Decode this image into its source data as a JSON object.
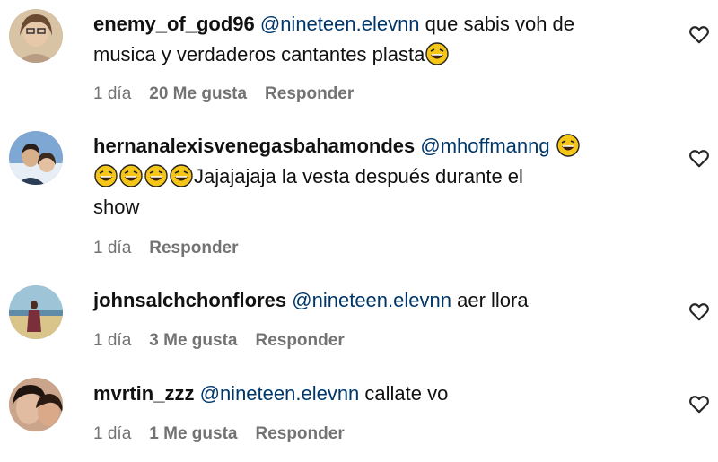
{
  "comments": [
    {
      "username": "enemy_of_god96",
      "mention": "@nineteen.elevnn",
      "text_line1": "que sabis voh de",
      "text_line2": "musica y verdaderos cantantes plasta",
      "emoji_name": "laughing-emoji",
      "time": "1 día",
      "likes": "20 Me gusta",
      "reply": "Responder"
    },
    {
      "username": "hernanalexisvenegasbahamondes",
      "mention": "@mhoffmanng",
      "text_line2": "Jajajajaja la vesta después durante el",
      "text_line3": "show",
      "emoji_name": "laughing-emoji",
      "time": "1 día",
      "reply": "Responder"
    },
    {
      "username": "johnsalchchonflores",
      "mention": "@nineteen.elevnn",
      "text": "aer llora",
      "time": "1 día",
      "likes": "3 Me gusta",
      "reply": "Responder"
    },
    {
      "username": "mvrtin_zzz",
      "mention": "@nineteen.elevnn",
      "text": "callate vo",
      "time": "1 día",
      "likes": "1 Me gusta",
      "reply": "Responder"
    }
  ],
  "colors": {
    "mention": "#00376b",
    "meta": "#737373",
    "emoji_face": "#f5c518"
  },
  "icons": {
    "like": "heart-outline-icon",
    "emoji": "laughing-emoji"
  }
}
